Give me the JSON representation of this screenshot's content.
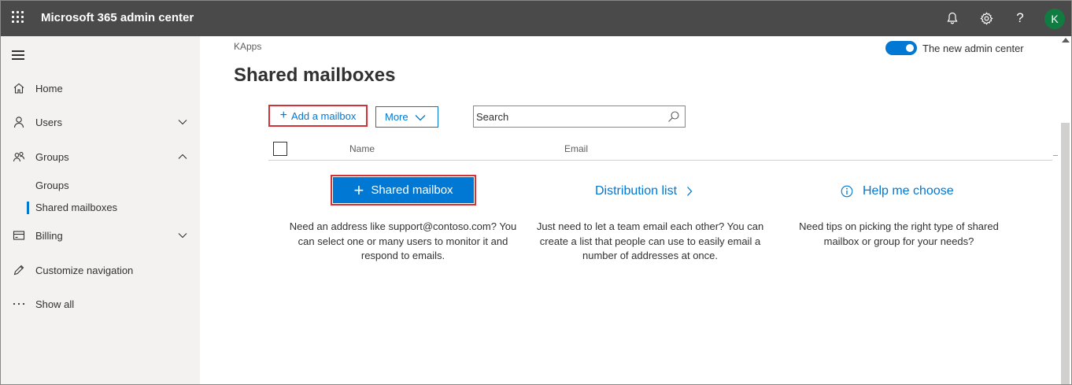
{
  "app": {
    "title": "Microsoft 365 admin center",
    "avatar_initial": "K"
  },
  "sidebar": {
    "items": [
      {
        "label": "Home",
        "icon": "home-icon"
      },
      {
        "label": "Users",
        "icon": "user-icon"
      },
      {
        "label": "Groups",
        "icon": "groups-icon"
      },
      {
        "label": "Billing",
        "icon": "billing-icon"
      },
      {
        "label": "Customize navigation",
        "icon": "pencil-icon"
      },
      {
        "label": "Show all",
        "icon": "more-icon"
      }
    ],
    "groups_sub": [
      {
        "label": "Groups"
      },
      {
        "label": "Shared mailboxes",
        "selected": true
      }
    ]
  },
  "main": {
    "breadcrumb": "KApps",
    "toggle_label": "The new admin center",
    "toggle_on": true,
    "page_title": "Shared mailboxes",
    "toolbar": {
      "add_label": "Add a mailbox",
      "more_label": "More",
      "search_placeholder": "Search"
    },
    "table": {
      "columns": [
        "Name",
        "Email"
      ]
    },
    "options": [
      {
        "label": "Shared mailbox",
        "desc": "Need an address like support@contoso.com? You can select one or many users to monitor it and respond to emails."
      },
      {
        "label": "Distribution list",
        "desc": "Just need to let a team email each other? You can create a list that people can use to easily email a number of addresses at once."
      },
      {
        "label": "Help me choose",
        "desc": "Need tips on picking the right type of shared mailbox or group for your needs?"
      }
    ]
  },
  "colors": {
    "accent": "#0078d4",
    "topbar": "#4a4a4a",
    "highlight": "#d13438",
    "avatar": "#107c41"
  }
}
